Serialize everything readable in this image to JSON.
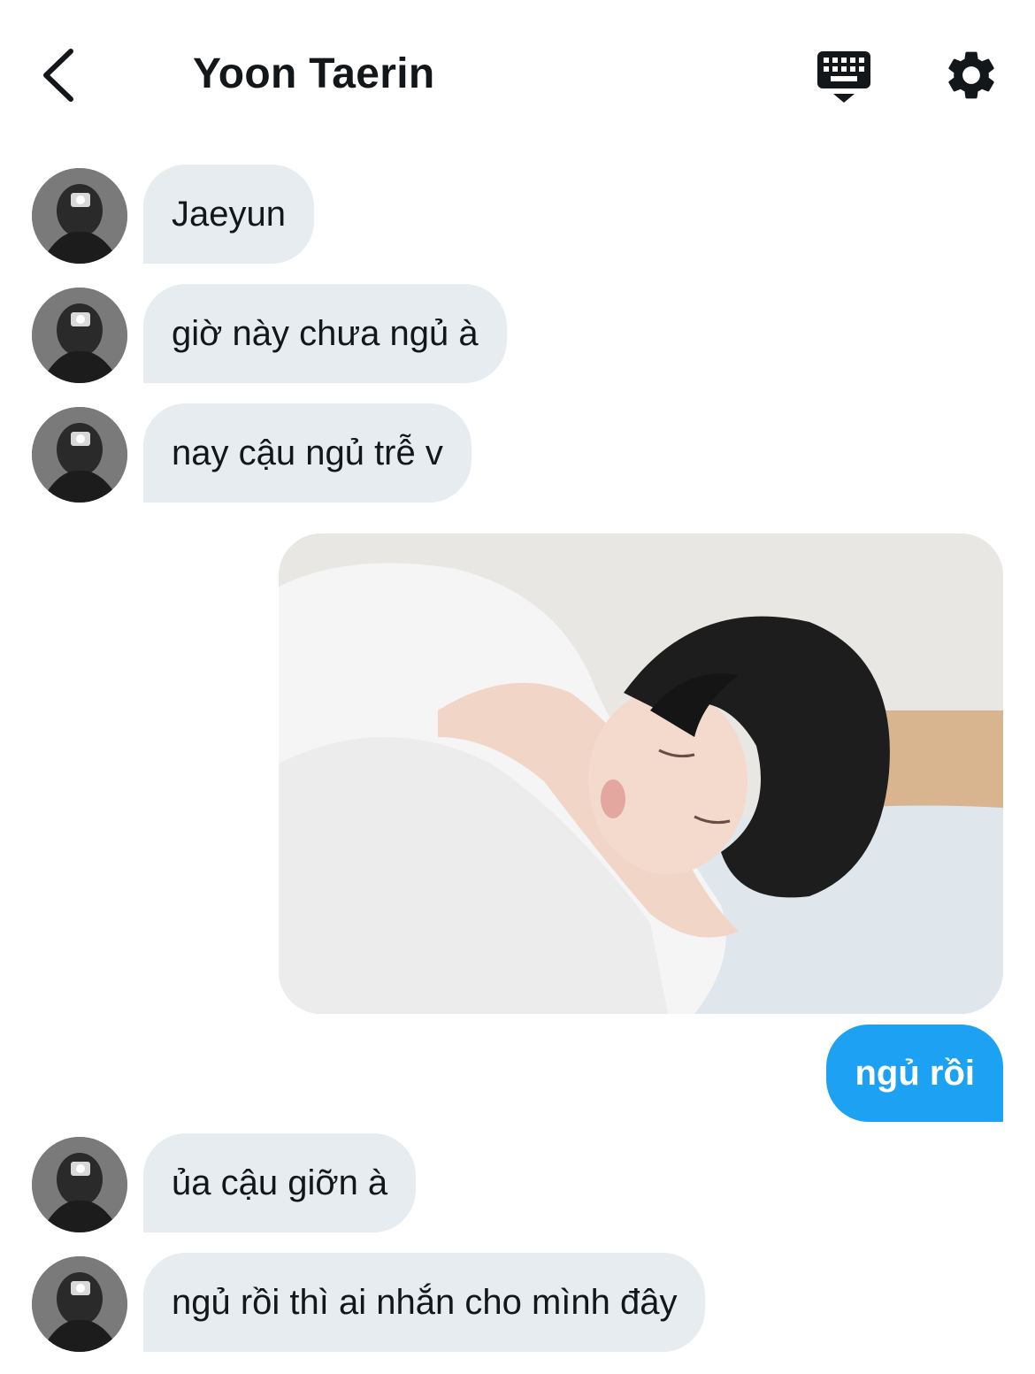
{
  "header": {
    "title": "Yoon Taerin",
    "back_icon": "chevron-left-icon",
    "keyboard_icon": "keyboard-icon",
    "settings_icon": "gear-icon"
  },
  "messages": [
    {
      "side": "incoming",
      "text": "Jaeyun"
    },
    {
      "side": "incoming",
      "text": "giờ này chưa ngủ à"
    },
    {
      "side": "incoming",
      "text": "nay cậu ngủ trễ v"
    },
    {
      "side": "outgoing",
      "type": "image",
      "description": "photo"
    },
    {
      "side": "outgoing",
      "text": "ngủ rồi"
    },
    {
      "side": "incoming",
      "text": "ủa cậu giỡn à"
    },
    {
      "side": "incoming",
      "text": "ngủ rồi thì ai nhắn cho mình đây"
    }
  ],
  "colors": {
    "incoming_bubble": "#e6ecf0",
    "outgoing_bubble": "#1da1f2",
    "text": "#14171a"
  }
}
